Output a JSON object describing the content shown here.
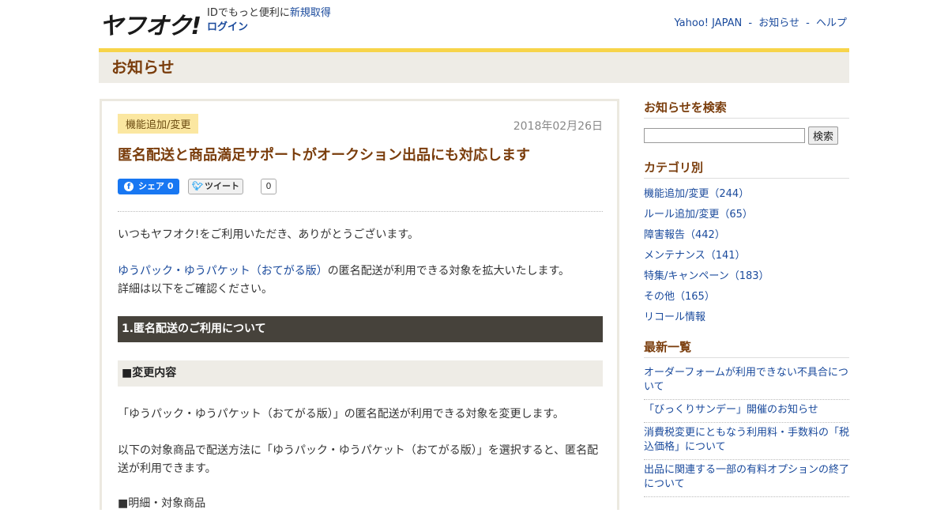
{
  "header": {
    "logo_text": "ヤフオク!",
    "login_lead": "IDでもっと便利に",
    "signup_link": "新規取得",
    "login_link": "ログイン",
    "top_links": [
      "Yahoo! JAPAN",
      "お知らせ",
      "ヘルプ"
    ],
    "top_separator": "-"
  },
  "page_title": "お知らせ",
  "article": {
    "category": "機能追加/変更",
    "date": "2018年02月26日",
    "title": "匿名配送と商品満足サポートがオークション出品にも対応します",
    "share_label": "シェア 0",
    "share_icon": "f",
    "tweet_label": "ツイート",
    "tweet_count": "0",
    "greeting": "いつもヤフオク!をご利用いただき、ありがとうございます。",
    "intro_link": "ゆうパック・ゆうパケット（おてがる版）",
    "intro_rest": "の匿名配送が利用できる対象を拡大いたします。",
    "intro_line2": "詳細は以下をご確認ください。",
    "section1_heading": "1.匿名配送のご利用について",
    "sub_heading": "■変更内容",
    "change_text": "「ゆうパック・ゆうパケット（おてがる版）」の匿名配送が利用できる対象を変更します。",
    "detail_text": "以下の対象商品で配送方法に「ゆうパック・ゆうパケット（おてがる版）」を選択すると、匿名配送が利用できます。",
    "cutoff_text": "■明細・対象商品"
  },
  "sidebar": {
    "search_heading": "お知らせを検索",
    "search_placeholder": "",
    "search_button": "検索",
    "category_heading": "カテゴリ別",
    "categories": [
      "機能追加/変更（244）",
      "ルール追加/変更（65）",
      "障害報告（442）",
      "メンテナンス（141）",
      "特集/キャンペーン（183）",
      "その他（165）",
      "リコール情報"
    ],
    "latest_heading": "最新一覧",
    "latest": [
      "オーダーフォームが利用できない不具合について",
      "「びっくりサンデー」開催のお知らせ",
      "消費税変更にともなう利用料・手数料の「税込価格」について",
      "出品に関連する一部の有料オプションの終了について"
    ]
  }
}
